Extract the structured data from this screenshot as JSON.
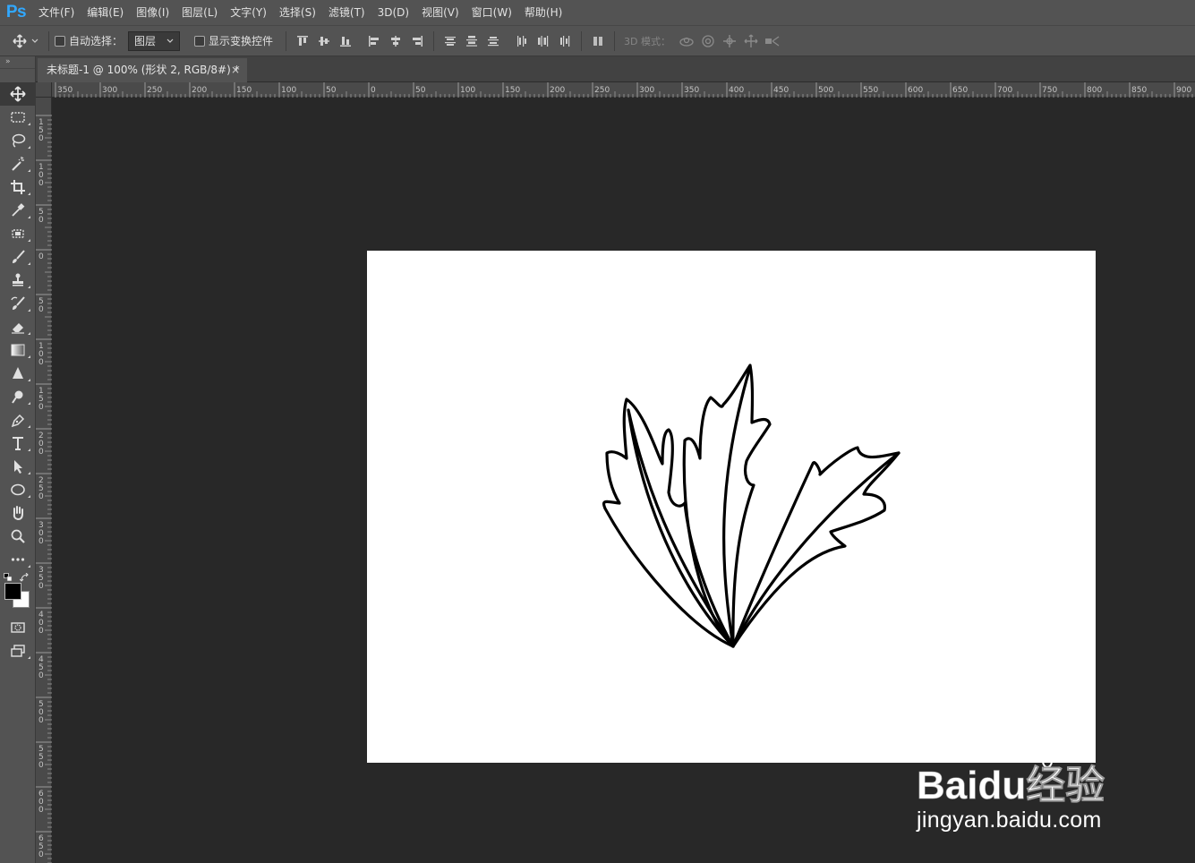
{
  "app": {
    "logo": "Ps"
  },
  "menu": [
    "文件(F)",
    "编辑(E)",
    "图像(I)",
    "图层(L)",
    "文字(Y)",
    "选择(S)",
    "滤镜(T)",
    "3D(D)",
    "视图(V)",
    "窗口(W)",
    "帮助(H)"
  ],
  "options": {
    "auto_select_label": "自动选择：",
    "auto_select_value": "图层",
    "show_transform_label": "显示变换控件",
    "mode_3d_label": "3D 模式："
  },
  "document": {
    "tab_title": "未标题-1 @ 100% (形状 2, RGB/8#) *",
    "close_glyph": "×"
  },
  "rulers": {
    "horizontal_labels": [
      "350",
      "300",
      "250",
      "200",
      "150",
      "100",
      "50",
      "0",
      "50",
      "100",
      "150",
      "200",
      "250",
      "300",
      "350",
      "400",
      "450",
      "500",
      "550",
      "600",
      "650",
      "700",
      "750",
      "800",
      "850",
      "900"
    ],
    "vertical_labels": [
      "150",
      "100",
      "50",
      "0",
      "50",
      "100",
      "150",
      "200",
      "250",
      "300",
      "350",
      "400",
      "450",
      "500",
      "550",
      "600",
      "650"
    ]
  },
  "tools": [
    "move-icon",
    "marquee-icon",
    "lasso-icon",
    "magic-wand-icon",
    "crop-icon",
    "eyedropper-icon",
    "healing-brush-icon",
    "brush-icon",
    "clone-stamp-icon",
    "history-brush-icon",
    "eraser-icon",
    "gradient-icon",
    "blur-icon",
    "dodge-icon",
    "pen-icon",
    "type-icon",
    "path-selection-icon",
    "ellipse-icon",
    "hand-icon",
    "zoom-icon",
    "more-icon"
  ],
  "colors": {
    "foreground": "#000000",
    "background": "#ffffff",
    "canvas": "#ffffff",
    "workspace": "#282828",
    "panel": "#535353"
  },
  "watermark": {
    "brand": "Baidu经验",
    "url": "jingyan.baidu.com"
  }
}
